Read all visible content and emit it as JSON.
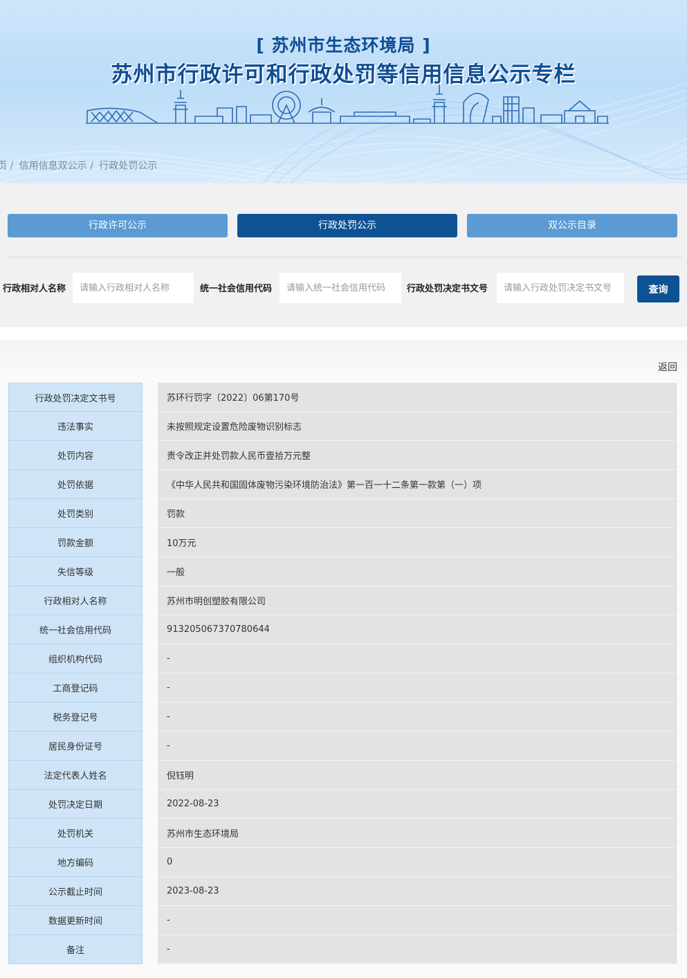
{
  "banner": {
    "subtitle": "[ 苏州市生态环境局 ]",
    "title": "苏州市行政许可和行政处罚等信用信息公示专栏"
  },
  "breadcrumb": [
    "页 /",
    "信用信息双公示 /",
    "行政处罚公示"
  ],
  "tabs": [
    {
      "label": "行政许可公示",
      "active": false
    },
    {
      "label": "行政处罚公示",
      "active": true
    },
    {
      "label": "双公示目录",
      "active": false
    }
  ],
  "search": {
    "fields": [
      {
        "label": "行政相对人名称",
        "placeholder": "请输入行政相对人名称"
      },
      {
        "label": "统一社会信用代码",
        "placeholder": "请输入统一社会信用代码"
      },
      {
        "label": "行政处罚决定书文号",
        "placeholder": "请输入行政处罚决定书文号"
      }
    ],
    "button": "查询"
  },
  "back_label": "返回",
  "details": [
    {
      "key": "行政处罚决定文书号",
      "value": "苏环行罚字〔2022〕06第170号"
    },
    {
      "key": "违法事实",
      "value": "未按照规定设置危险废物识别标志"
    },
    {
      "key": "处罚内容",
      "value": "责令改正并处罚款人民币壹拾万元整"
    },
    {
      "key": "处罚依据",
      "value": "《中华人民共和国固体废物污染环境防治法》第一百一十二条第一款第（一）项"
    },
    {
      "key": "处罚类别",
      "value": "罚款"
    },
    {
      "key": "罚款金额",
      "value": "10万元"
    },
    {
      "key": "失信等级",
      "value": "一般"
    },
    {
      "key": "行政相对人名称",
      "value": "苏州市明创塑胶有限公司"
    },
    {
      "key": "统一社会信用代码",
      "value": "913205067370780644"
    },
    {
      "key": "组织机构代码",
      "value": "-"
    },
    {
      "key": "工商登记码",
      "value": "-"
    },
    {
      "key": "税务登记号",
      "value": "-"
    },
    {
      "key": "居民身份证号",
      "value": "-"
    },
    {
      "key": "法定代表人姓名",
      "value": "倪钰明"
    },
    {
      "key": "处罚决定日期",
      "value": "2022-08-23"
    },
    {
      "key": "处罚机关",
      "value": "苏州市生态环境局"
    },
    {
      "key": "地方编码",
      "value": "0"
    },
    {
      "key": "公示截止时间",
      "value": "2023-08-23"
    },
    {
      "key": "数据更新时间",
      "value": "-"
    },
    {
      "key": "备注",
      "value": "-"
    }
  ]
}
